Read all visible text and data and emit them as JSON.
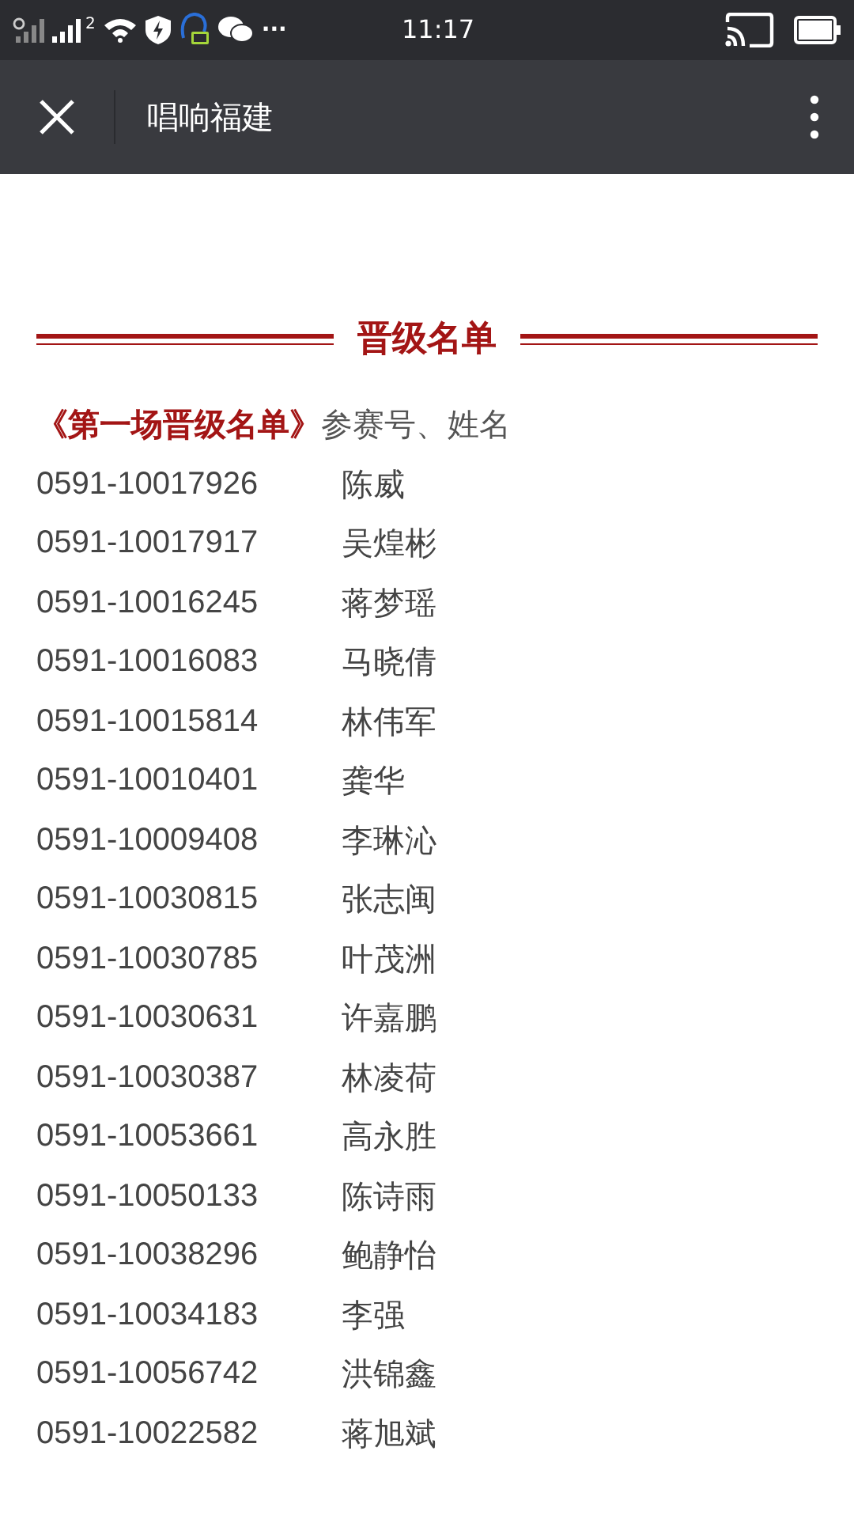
{
  "status_bar": {
    "sim_label": "2",
    "more": "···",
    "time": "11:17"
  },
  "nav_bar": {
    "title": "唱响福建"
  },
  "section": {
    "heading": "晋级名单"
  },
  "intro": {
    "title": "《第一场晋级名单》",
    "caption": "参赛号、姓名"
  },
  "entries": [
    {
      "number": "0591-10017926",
      "name": "陈威"
    },
    {
      "number": "0591-10017917",
      "name": "吴煌彬"
    },
    {
      "number": "0591-10016245",
      "name": "蒋梦瑶"
    },
    {
      "number": "0591-10016083",
      "name": "马晓倩"
    },
    {
      "number": "0591-10015814",
      "name": "林伟军"
    },
    {
      "number": "0591-10010401",
      "name": "龚华"
    },
    {
      "number": "0591-10009408",
      "name": "李琳沁"
    },
    {
      "number": "0591-10030815",
      "name": "张志闽"
    },
    {
      "number": "0591-10030785",
      "name": "叶茂洲"
    },
    {
      "number": "0591-10030631",
      "name": "许嘉鹏"
    },
    {
      "number": "0591-10030387",
      "name": "林凌荷"
    },
    {
      "number": "0591-10053661",
      "name": "高永胜"
    },
    {
      "number": "0591-10050133",
      "name": "陈诗雨"
    },
    {
      "number": "0591-10038296",
      "name": "鲍静怡"
    },
    {
      "number": "0591-10034183",
      "name": "李强"
    },
    {
      "number": "0591-10056742",
      "name": "洪锦鑫"
    },
    {
      "number": "0591-10022582",
      "name": "蒋旭斌"
    }
  ]
}
